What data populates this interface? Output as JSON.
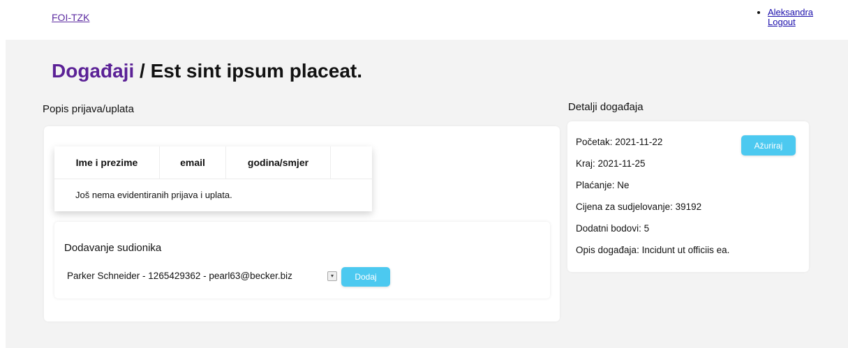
{
  "nav": {
    "brand": "FOI-TZK",
    "user": "Aleksandra",
    "logout": "Logout"
  },
  "page": {
    "breadcrumb": "Događaji",
    "separator": "/",
    "title": "Est sint ipsum placeat."
  },
  "registrations": {
    "heading": "Popis prijava/uplata",
    "columns": [
      "Ime i prezime",
      "email",
      "godina/smjer"
    ],
    "empty_message": "Još nema evidentiranih prijava i uplata."
  },
  "add_participant": {
    "heading": "Dodavanje sudionika",
    "selected_option": "Parker Schneider - 1265429362 - pearl63@becker.biz",
    "add_button": "Dodaj"
  },
  "details": {
    "heading": "Detalji događaja",
    "update_button": "Ažuriraj",
    "start": "Početak: 2021-11-22",
    "end": "Kraj: 2021-11-25",
    "payment": "Plaćanje: Ne",
    "price": "Cijena za sudjelovanje: 39192",
    "extra_points": "Dodatni bodovi: 5",
    "description": "Opis događaja: Incidunt ut officiis ea."
  },
  "colors": {
    "accent": "#4cc9f0",
    "breadcrumb": "#5b2196",
    "background": "#f3f3f3"
  }
}
